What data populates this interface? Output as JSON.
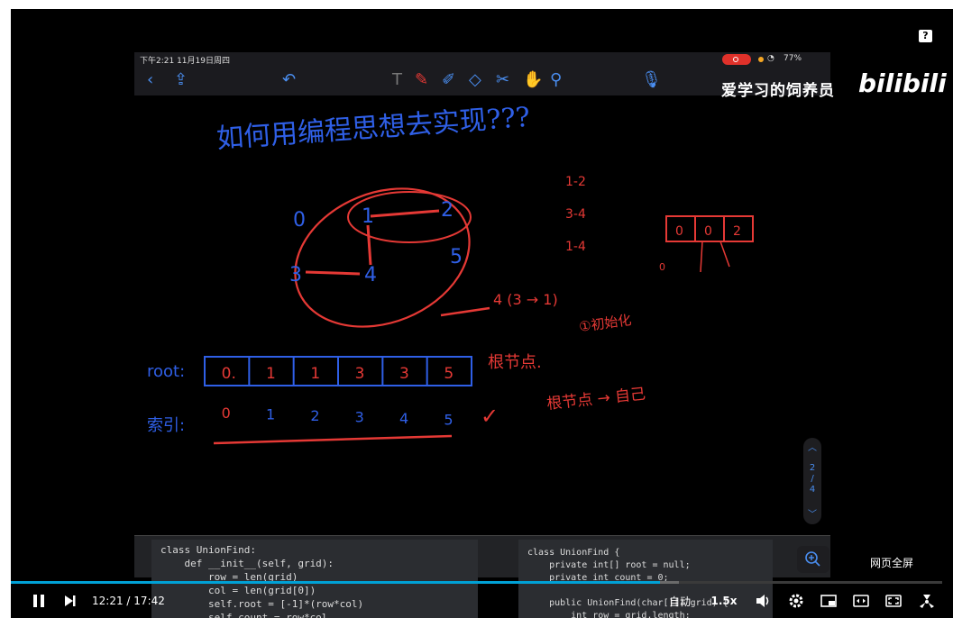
{
  "player": {
    "watermark_text": "爱学习的饲养员",
    "brand": "bilibili",
    "help_label": "?",
    "webpage_fullscreen_label": "网页全屏",
    "current_time": "12:21",
    "time_separator": "/",
    "duration": "17:42",
    "progress_fraction": 0.697,
    "auto_label": "自动",
    "speed_label": "1.5x",
    "accent_color": "#00a1d6",
    "icons": [
      "pause-icon",
      "next-icon",
      "volume-icon",
      "settings-icon",
      "pip-icon",
      "widescreen-icon",
      "fullscreen-icon",
      "danmaku-icon"
    ]
  },
  "ios": {
    "status_time": "下午2:21  11月19日周四",
    "battery": "77%",
    "toolbar_icons": [
      "back-icon",
      "share-icon",
      "undo-icon",
      "text-tool-icon",
      "pen-icon",
      "highlighter-icon",
      "eraser-icon",
      "scissors-icon",
      "hand-icon",
      "lasso-icon",
      "mic-icon"
    ],
    "pager": {
      "current": "2",
      "separator": "/",
      "total": "4"
    }
  },
  "whiteboard": {
    "title": "如何用编程思想去实现???",
    "graph_nodes": [
      "0",
      "1",
      "2",
      "3",
      "4",
      "5"
    ],
    "edge_list": [
      "1-2",
      "3-4",
      "1-4"
    ],
    "mini_array": [
      "0",
      "0",
      "2"
    ],
    "mini_index": "0",
    "union_note": "4 (3 → 1)",
    "update_note": "①初始化",
    "root_label": "root:",
    "root_values": [
      "0.",
      "1",
      "1",
      "3",
      "3",
      "5"
    ],
    "root_note": "根节点.",
    "index_label": "索引:",
    "index_values": [
      "0",
      "1",
      "2",
      "3",
      "4",
      "5"
    ],
    "root_arrow_note": "根节点 → 自己",
    "check_mark": "✓"
  },
  "code": {
    "python": "class UnionFind:\n    def __init__(self, grid):\n        row = len(grid)\n        col = len(grid[0])\n        self.root = [-1]*(row*col)\n        self.count = row*col",
    "java": "class UnionFind {\n    private int[] root = null;\n    private int count = 0;\n\n    public UnionFind(char[][] grid) {\n        int row = grid.length;"
  }
}
